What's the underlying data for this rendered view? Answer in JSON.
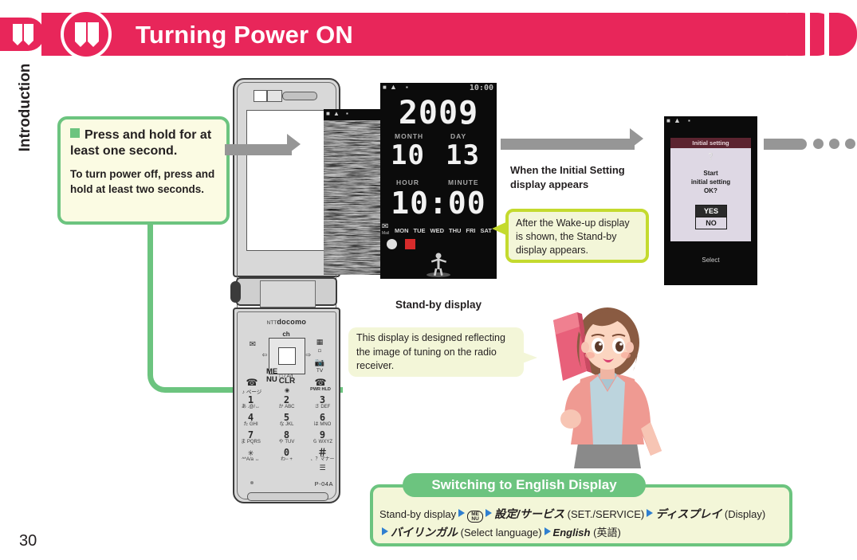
{
  "header": {
    "title": "Turning Power ON",
    "accent_color": "#e8265a",
    "badge_icon": "book-icon"
  },
  "side_tab": {
    "label": "Introduction"
  },
  "page": {
    "number": "30"
  },
  "callout_press": {
    "bullet_icon": "green-square-bullet",
    "heading": "Press and hold for at least one second.",
    "body": "To turn power off, press and hold at least two seconds."
  },
  "phone": {
    "brand": "docomo",
    "brand_prefix": "NTT",
    "model": "P-04A",
    "menu_key_label": "ME\nNU",
    "keys": {
      "soft_left_icon": "mail-icon",
      "soft_center_icon": "i-mode-icon",
      "soft_right_icon": "memo-icon",
      "camera_icon": "camera-icon",
      "dpad_top": "ch",
      "dpad_bottom": "□ / A/I",
      "power_key_label": "PWR HLD",
      "clear_key_label": "CLR",
      "rows": [
        {
          "num": "1",
          "sub": "あ .@/↔"
        },
        {
          "num": "2",
          "sub": "か ABC"
        },
        {
          "num": "3",
          "sub": "さ DEF"
        },
        {
          "num": "4",
          "sub": "た GHI"
        },
        {
          "num": "5",
          "sub": "な JKL"
        },
        {
          "num": "6",
          "sub": "は MNO"
        },
        {
          "num": "7",
          "sub": "ま PQRS"
        },
        {
          "num": "8",
          "sub": "や TUV"
        },
        {
          "num": "9",
          "sub": "ら WXYZ"
        },
        {
          "num": "✳",
          "sub": "^^A/a ↔"
        },
        {
          "num": "0",
          "sub": "わ− +"
        },
        {
          "num": "＃",
          "sub": "、？マナー"
        }
      ]
    },
    "highlight_color": "#6cc47f"
  },
  "wakeup_screen": {
    "name": "Wake-up display",
    "description": "radio tuning noise image"
  },
  "standby_screen": {
    "label": "Stand-by display",
    "status_time": "10:00",
    "status_icons": [
      "battery-icon",
      "signal-icon",
      "mail-icon"
    ],
    "year": "2009",
    "month_label": "MONTH",
    "day_label": "DAY",
    "month": "10",
    "day": "13",
    "hour_label": "HOUR",
    "minute_label": "MINUTE",
    "time": "10:00",
    "weekdays": [
      "MON",
      "TUE",
      "WED",
      "THU",
      "FRI",
      "SAT"
    ],
    "mail_label": "Mail"
  },
  "initial_screen": {
    "title": "Initial setting",
    "question_icon": "question-mark-icon",
    "body": "Start\ninitial setting\nOK?",
    "yes_label": "YES",
    "no_label": "NO",
    "softkey": "Select"
  },
  "label_initial_setting": "When the Initial Setting display appears",
  "callout_wake": {
    "text": "After the Wake-up display is shown, the Stand-by display appears."
  },
  "callout_radio": {
    "text": "This display is designed reflecting the image of tuning on the radio receiver."
  },
  "switch_box": {
    "tab_title": "Switching to English Display",
    "line1_start": "Stand-by display",
    "menu_key": "ME\nNU",
    "item1_jp": "設定/サービス",
    "item1_en": "(SET./SERVICE)",
    "item2_jp": "ディスプレイ",
    "item2_en": "(Display)",
    "item3_jp": "バイリンガル",
    "item3_en": "(Select language)",
    "item4_en": "English",
    "item4_jp": "(英語)"
  },
  "character": {
    "description": "woman holding pink mobile phone"
  }
}
